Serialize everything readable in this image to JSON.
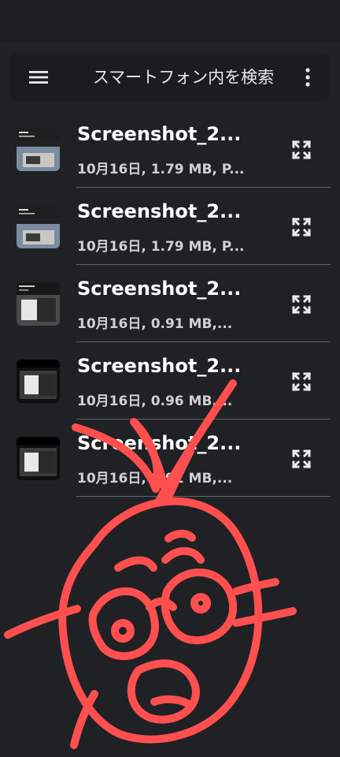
{
  "header": {
    "search_title": "スマートフォン内を検索",
    "icons": {
      "menu": "menu-icon",
      "more": "more-vert-icon"
    }
  },
  "files": [
    {
      "title": "Screenshot_2...",
      "meta": "10月16日, 1.79 MB, P..."
    },
    {
      "title": "Screenshot_2...",
      "meta": "10月16日, 1.79 MB, P..."
    },
    {
      "title": "Screenshot_2...",
      "meta": "10月16日, 0.91 MB,..."
    },
    {
      "title": "Screenshot_2...",
      "meta": "10月16日, 0.96 MB,..."
    },
    {
      "title": "Screenshot_2...",
      "meta": "10月16日, 0.91 MB,..."
    }
  ],
  "colors": {
    "background": "#202124",
    "text": "#e8eaed",
    "divider": "#5f6368",
    "annotation": "#ff4f4f"
  }
}
